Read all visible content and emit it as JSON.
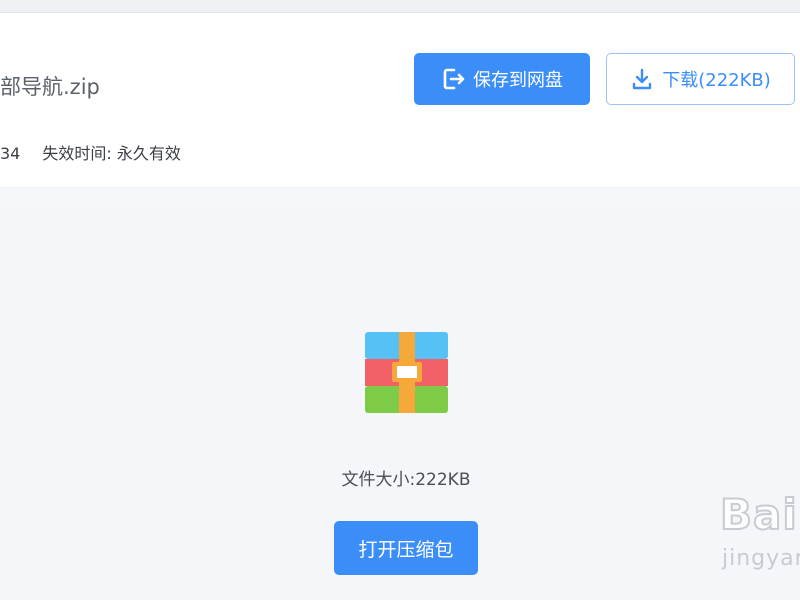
{
  "file": {
    "name": "部导航.zip",
    "meta_left": "34",
    "expiry_label": "失效时间:",
    "expiry_value": "永久有效"
  },
  "actions": {
    "save_label": "保存到网盘",
    "download_label": "下载(222KB)"
  },
  "content": {
    "size_text": "文件大小:222KB",
    "open_label": "打开压缩包"
  },
  "watermark": {
    "main": "Bai",
    "sub": "jingyan"
  },
  "colors": {
    "primary": "#3b8ef8",
    "zip_blue": "#56c1f5",
    "zip_red": "#f26067",
    "zip_green": "#7ecb47",
    "zip_band": "#f6a93b"
  }
}
